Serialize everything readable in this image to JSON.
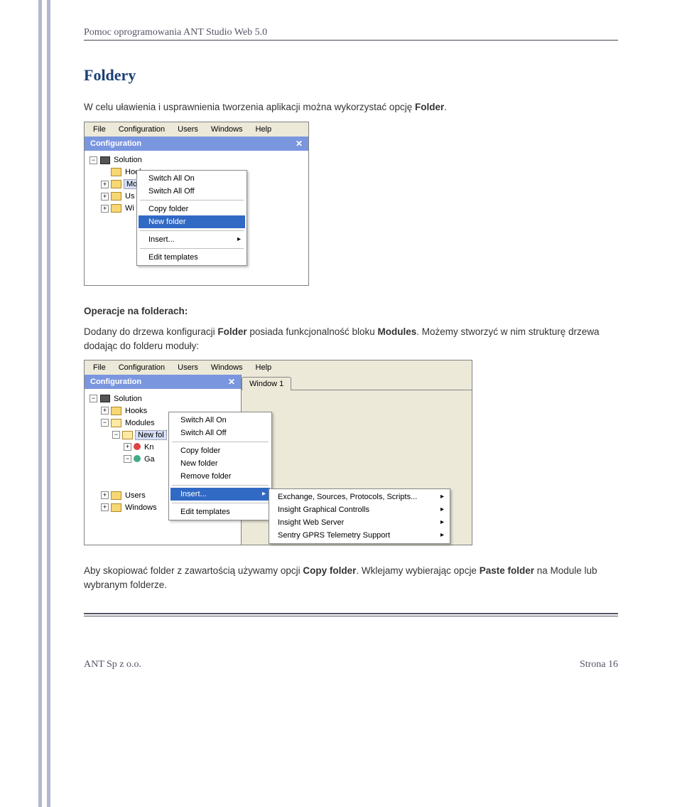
{
  "header": {
    "text": "Pomoc oprogramowania ANT Studio Web 5.0"
  },
  "section_title": "Foldery",
  "intro_text": "W celu uławienia i usprawnienia tworzenia aplikacji można wykorzystać opcję ",
  "intro_bold": "Folder",
  "intro_tail": ".",
  "ops_heading": "Operacje na folderach:",
  "ops_text_1a": "Dodany do drzewa konfiguracji ",
  "ops_text_1b": "Folder",
  "ops_text_1c": " posiada funkcjonalność bloku ",
  "ops_text_1d": "Modules",
  "ops_text_1e": ". Możemy stworzyć w nim strukturę drzewa dodając do folderu moduły:",
  "copy_text_1a": "Aby skopiować folder z zawartością używamy opcji ",
  "copy_text_1b": "Copy folder",
  "copy_text_1c": ". Wklejamy wybierając opcje ",
  "copy_text_1d": "Paste folder",
  "copy_text_1e": " na Module lub wybranym folderze.",
  "menubar": [
    "File",
    "Configuration",
    "Users",
    "Windows",
    "Help"
  ],
  "panel_title": "Configuration",
  "ss1": {
    "tree": {
      "root": "Solution",
      "items": [
        "Hooks",
        "Mo",
        "Us",
        "Wi"
      ]
    },
    "ctx": [
      "Switch All On",
      "Switch All Off",
      "Copy folder",
      "New folder",
      "Insert...",
      "Edit templates"
    ],
    "ctx_highlight": "New folder"
  },
  "ss2": {
    "tree": {
      "root": "Solution",
      "lvl1": [
        "Hooks",
        "Modules"
      ],
      "lvl2": [
        "New fol"
      ],
      "lvl3": [
        "Kn",
        "Ga"
      ],
      "bottom": [
        "Users",
        "Windows"
      ]
    },
    "ctx": [
      "Switch All On",
      "Switch All Off",
      "Copy folder",
      "New folder",
      "Remove folder",
      "Insert...",
      "Edit templates"
    ],
    "ctx_highlight": "Insert...",
    "sub": [
      "Exchange, Sources, Protocols, Scripts...",
      "Insight Graphical Controlls",
      "Insight Web Server",
      "Sentry GPRS Telemetry Support"
    ],
    "tab_label": "Window 1"
  },
  "footer": {
    "left": "ANT Sp z o.o.",
    "right": "Strona 16"
  }
}
